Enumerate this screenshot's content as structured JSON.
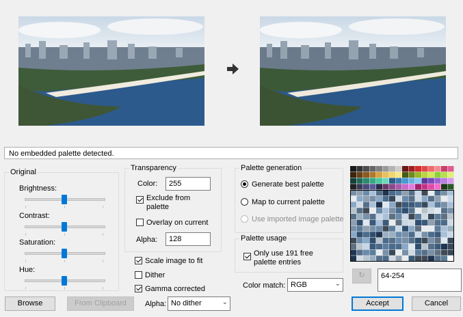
{
  "images": {
    "before_alt": "Original image",
    "after_alt": "Converted image"
  },
  "status": {
    "text": "No embedded palette detected."
  },
  "original": {
    "legend": "Original",
    "sliders": [
      {
        "label": "Brightness:",
        "value": 50
      },
      {
        "label": "Contrast:",
        "value": 50
      },
      {
        "label": "Saturation:",
        "value": 50
      },
      {
        "label": "Hue:",
        "value": 50
      }
    ]
  },
  "transparency": {
    "legend": "Transparency",
    "color_label": "Color:",
    "color_value": "255",
    "exclude_label": "Exclude from palette",
    "exclude_checked": true,
    "overlay_label": "Overlay on current",
    "overlay_checked": false,
    "alpha_label": "Alpha:",
    "alpha_value": "128"
  },
  "options": {
    "scale_label": "Scale image to fit",
    "scale_checked": true,
    "dither_label": "Dither",
    "dither_checked": false,
    "gamma_label": "Gamma corrected",
    "gamma_checked": true
  },
  "palette_generation": {
    "legend": "Palette generation",
    "best_label": "Generate best palette",
    "map_label": "Map to current palette",
    "imported_label": "Use imported image palette"
  },
  "palette_usage": {
    "legend": "Palette usage",
    "only_label": "Only use 191 free palette entries",
    "only_checked": true
  },
  "color_match": {
    "label": "Color match:",
    "value": "RGB"
  },
  "range": {
    "value": "64-254"
  },
  "bottom": {
    "browse": "Browse",
    "clipboard": "From Clipboard",
    "alpha_label": "Alpha:",
    "alpha_value": "No dither",
    "accept": "Accept",
    "cancel": "Cancel"
  },
  "colors": {
    "accent": "#0078d7"
  }
}
